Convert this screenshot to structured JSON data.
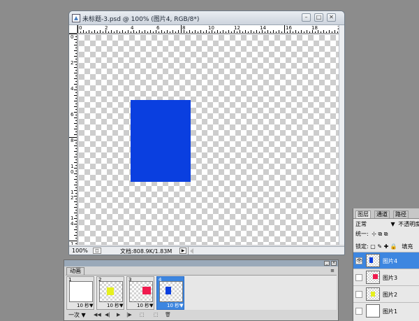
{
  "document": {
    "title": "未标题-3.psd @ 100% (图片4, RGB/8*)",
    "min_glyph": "–",
    "max_glyph": "□",
    "close_glyph": "✕",
    "ruler_h_labels": [
      "0",
      "2",
      "4",
      "6",
      "8",
      "10",
      "12",
      "14",
      "16",
      "18",
      "2"
    ],
    "ruler_v_labels": [
      "0",
      "2",
      "4",
      "6",
      "8",
      "1",
      "0",
      "1",
      "2",
      "1",
      "4",
      "1",
      "6"
    ],
    "canvas_colors": {
      "rect": "#0a3fe0"
    },
    "zoom": "100%",
    "doc_size": "文档:808.9K/1.83M",
    "arrow_glyph": "▶"
  },
  "animation_panel": {
    "tab_label": "动画",
    "menu_glyph": "≡",
    "frames": [
      {
        "number": "1",
        "delay": "10 秒▼",
        "swatch_color": ""
      },
      {
        "number": "2",
        "delay": "10 秒▼",
        "swatch_color": "#e6f01e"
      },
      {
        "number": "3",
        "delay": "10 秒▼",
        "swatch_color": "#f01a4e"
      },
      {
        "number": "4",
        "delay": "10 秒▼",
        "swatch_color": "#0a3fe0"
      }
    ],
    "loop_label": "一次 ▼",
    "controls": [
      "◀◀",
      "◀|",
      "▶",
      "|▶",
      "⬚",
      "⬚",
      "🗑"
    ]
  },
  "layers_panel": {
    "tabs": [
      "图层",
      "通道",
      "路径"
    ],
    "blend_mode": "正常",
    "blend_arrow": "▼",
    "opacity_label": "不透明度",
    "unify_label": "统一:",
    "lock_label": "锁定:",
    "fill_label": "填充",
    "layers": [
      {
        "name": "图片4",
        "swatch_color": "#0a3fe0",
        "visible": true,
        "selected": true
      },
      {
        "name": "图片3",
        "swatch_color": "#f01a4e",
        "visible": false,
        "selected": false
      },
      {
        "name": "图片2",
        "swatch_color": "#e6f01e",
        "visible": false,
        "selected": false
      },
      {
        "name": "图片1",
        "swatch_color": "",
        "visible": false,
        "selected": false
      }
    ],
    "eye_glyph": "👁"
  }
}
